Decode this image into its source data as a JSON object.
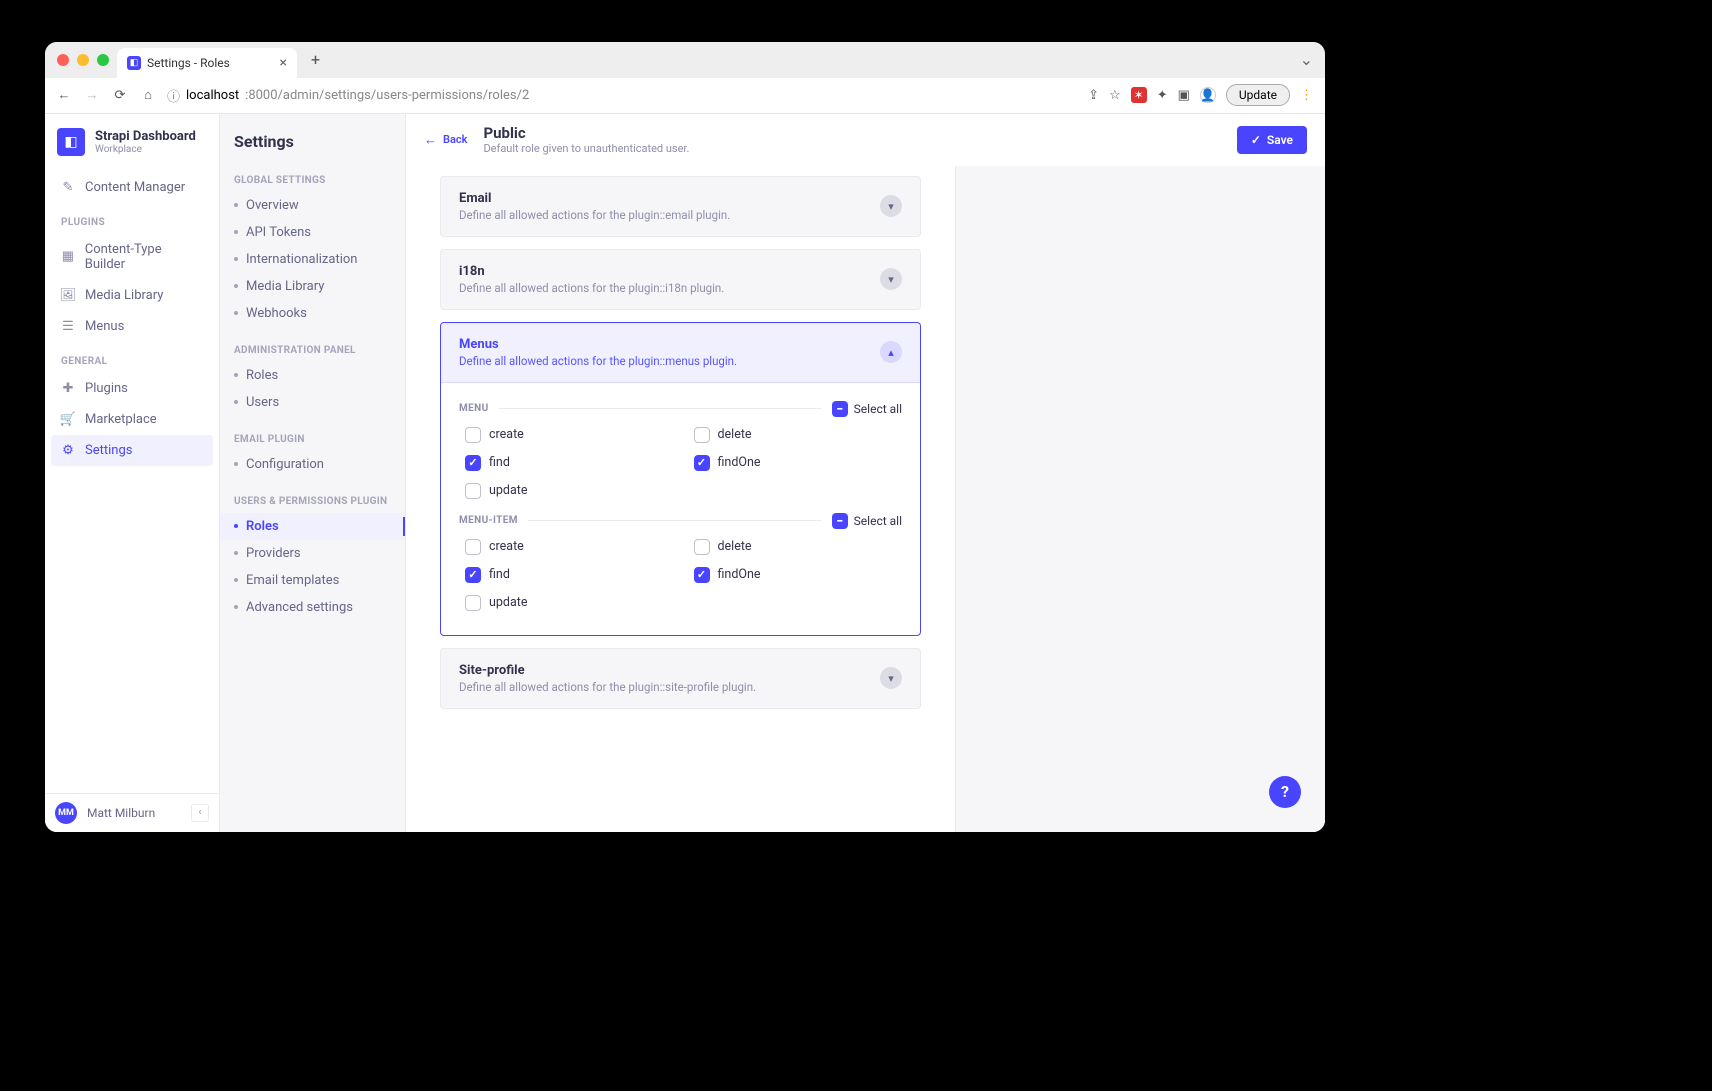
{
  "browser": {
    "tab_title": "Settings - Roles",
    "url_host": "localhost",
    "url_path": ":8000/admin/settings/users-permissions/roles/2",
    "update_label": "Update"
  },
  "sidebar1": {
    "brand_title": "Strapi Dashboard",
    "brand_subtitle": "Workplace",
    "content_manager": "Content Manager",
    "heading_plugins": "Plugins",
    "items_plugins": {
      "content_type_builder": "Content-Type Builder",
      "media_library": "Media Library",
      "menus": "Menus"
    },
    "heading_general": "General",
    "items_general": {
      "plugins": "Plugins",
      "marketplace": "Marketplace",
      "settings": "Settings"
    },
    "user_name": "Matt Milburn",
    "user_initials": "MM"
  },
  "sidebar2": {
    "title": "Settings",
    "groups": [
      {
        "heading": "Global Settings",
        "items": [
          "Overview",
          "API Tokens",
          "Internationalization",
          "Media Library",
          "Webhooks"
        ]
      },
      {
        "heading": "Administration Panel",
        "items": [
          "Roles",
          "Users"
        ]
      },
      {
        "heading": "Email Plugin",
        "items": [
          "Configuration"
        ]
      },
      {
        "heading": "Users & Permissions Plugin",
        "items": [
          "Roles",
          "Providers",
          "Email templates",
          "Advanced settings"
        ]
      }
    ],
    "active_item": "Roles"
  },
  "main": {
    "back_label": "Back",
    "title": "Public",
    "subtitle": "Default role given to unauthenticated user.",
    "save_label": "Save"
  },
  "panels": [
    {
      "title": "Email",
      "desc": "Define all allowed actions for the plugin::email plugin.",
      "expanded": false
    },
    {
      "title": "i18n",
      "desc": "Define all allowed actions for the plugin::i18n plugin.",
      "expanded": false
    },
    {
      "title": "Menus",
      "desc": "Define all allowed actions for the plugin::menus plugin.",
      "expanded": true
    },
    {
      "title": "Site-profile",
      "desc": "Define all allowed actions for the plugin::site-profile plugin.",
      "expanded": false
    }
  ],
  "menus_panel": {
    "select_all_label": "Select all",
    "groups": [
      {
        "label": "MENU",
        "perms": [
          {
            "name": "create",
            "checked": false
          },
          {
            "name": "delete",
            "checked": false
          },
          {
            "name": "find",
            "checked": true
          },
          {
            "name": "findOne",
            "checked": true
          },
          {
            "name": "update",
            "checked": false
          }
        ]
      },
      {
        "label": "MENU-ITEM",
        "perms": [
          {
            "name": "create",
            "checked": false
          },
          {
            "name": "delete",
            "checked": false
          },
          {
            "name": "find",
            "checked": true
          },
          {
            "name": "findOne",
            "checked": true
          },
          {
            "name": "update",
            "checked": false
          }
        ]
      }
    ]
  }
}
